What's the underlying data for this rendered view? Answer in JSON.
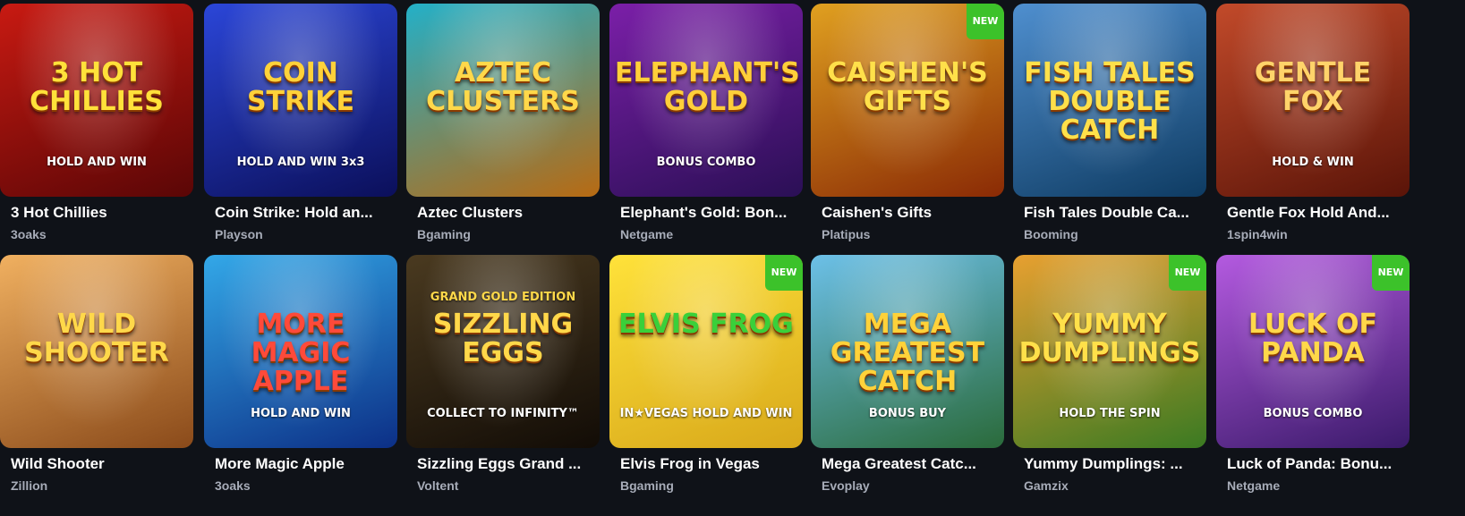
{
  "games": [
    {
      "title": "3 Hot Chillies",
      "provider": "3oaks",
      "logo": "3 HOT CHILLIES",
      "sub": "HOLD AND WIN",
      "new": false,
      "bg": [
        "#c81a12",
        "#5a0606"
      ],
      "logo_color": "#ffe13a"
    },
    {
      "title": "Coin Strike: Hold an...",
      "provider": "Playson",
      "logo": "COIN STRIKE",
      "sub": "HOLD AND WIN 3x3",
      "new": false,
      "bg": [
        "#2b46d8",
        "#0b0f5a"
      ],
      "logo_color": "#ffd23a"
    },
    {
      "title": "Aztec Clusters",
      "provider": "Bgaming",
      "logo": "AZTEC CLUSTERS",
      "sub": "",
      "new": false,
      "bg": [
        "#23b0c8",
        "#b86a12"
      ],
      "logo_color": "#ffd84a"
    },
    {
      "title": "Elephant's Gold: Bon...",
      "provider": "Netgame",
      "logo": "ELEPHANT'S GOLD",
      "sub": "BONUS COMBO",
      "new": false,
      "bg": [
        "#7b1fa8",
        "#2a0f55"
      ],
      "logo_color": "#ffcf3a"
    },
    {
      "title": "Caishen's Gifts",
      "provider": "Platipus",
      "logo": "CAISHEN'S GIFTS",
      "sub": "",
      "new": true,
      "bg": [
        "#e0a020",
        "#8a2a05"
      ],
      "logo_color": "#ffe04a"
    },
    {
      "title": "Fish Tales Double Ca...",
      "provider": "Booming",
      "logo": "FISH TALES DOUBLE CATCH",
      "sub": "",
      "new": false,
      "bg": [
        "#4f8fcf",
        "#0e3b62"
      ],
      "logo_color": "#ffe04a"
    },
    {
      "title": "Gentle Fox Hold And...",
      "provider": "1spin4win",
      "logo": "GENTLE FOX",
      "sub": "HOLD & WIN",
      "new": false,
      "bg": [
        "#c24a2a",
        "#5a1408"
      ],
      "logo_color": "#ffd36a"
    },
    {
      "title": "Wild Shooter",
      "provider": "Zillion",
      "logo": "WILD SHOOTER",
      "sub": "",
      "new": false,
      "bg": [
        "#f0b060",
        "#8a4a1a"
      ],
      "logo_color": "#ffd84a"
    },
    {
      "title": "More Magic Apple",
      "provider": "3oaks",
      "logo": "MORE MAGIC APPLE",
      "sub": "HOLD AND WIN",
      "new": false,
      "bg": [
        "#33a8e8",
        "#0c2f86"
      ],
      "logo_color": "#ff4a3a"
    },
    {
      "title": "Sizzling Eggs Grand ...",
      "provider": "Voltent",
      "logo": "SIZZLING EGGS",
      "sub": "COLLECT TO INFINITY™",
      "pre": "GRAND GOLD EDITION",
      "new": false,
      "bg": [
        "#4a3a20",
        "#120c06"
      ],
      "logo_color": "#ffd84a"
    },
    {
      "title": "Elvis Frog in Vegas",
      "provider": "Bgaming",
      "logo": "ELVIS FROG",
      "sub": "IN★VEGAS HOLD AND WIN",
      "new": true,
      "bg": [
        "#ffe23a",
        "#d8a81a"
      ],
      "logo_color": "#3ad03a"
    },
    {
      "title": "Mega Greatest Catc...",
      "provider": "Evoplay",
      "logo": "MEGA GREATEST CATCH",
      "sub": "BONUS BUY",
      "new": false,
      "bg": [
        "#6cc0e8",
        "#2a6a3a"
      ],
      "logo_color": "#ffd23a"
    },
    {
      "title": "Yummy Dumplings: ...",
      "provider": "Gamzix",
      "logo": "YUMMY DUMPLINGS",
      "sub": "HOLD THE SPIN",
      "new": true,
      "bg": [
        "#e8a030",
        "#3a7a22"
      ],
      "logo_color": "#ffe04a"
    },
    {
      "title": "Luck of Panda: Bonu...",
      "provider": "Netgame",
      "logo": "LUCK OF PANDA",
      "sub": "BONUS COMBO",
      "new": true,
      "bg": [
        "#b45ae0",
        "#3a1a6a"
      ],
      "logo_color": "#ffd84a"
    }
  ],
  "new_badge": "NEW"
}
